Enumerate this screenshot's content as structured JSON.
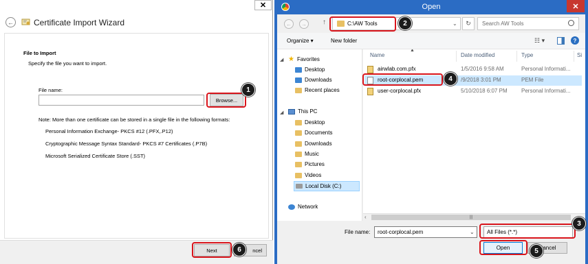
{
  "wizard": {
    "title": "Certificate Import Wizard",
    "close_glyph": "✕",
    "back_glyph": "←",
    "heading": "File to Import",
    "subheading": "Specify the file you want to import.",
    "file_name_label": "File name:",
    "file_name_value": "",
    "browse_label": "Browse...",
    "note": "Note:  More than one certificate can be stored in a single file in the following formats:",
    "formats": [
      "Personal Information Exchange- PKCS #12 (.PFX,.P12)",
      "Cryptographic Message Syntax Standard- PKCS #7 Certificates (.P7B)",
      "Microsoft Serialized Certificate Store (.SST)"
    ],
    "next_label": "Next",
    "cancel_label": "ncel"
  },
  "open_dialog": {
    "title": "Open",
    "close_glyph": "✕",
    "address": "C:\\AW Tools",
    "search_placeholder": "Search AW Tools",
    "toolbar": {
      "organize": "Organize ▾",
      "new_folder": "New folder",
      "view_glyph": "☷ ▾",
      "help_glyph": "?"
    },
    "nav": {
      "favorites": "Favorites",
      "favorites_items": [
        "Desktop",
        "Downloads",
        "Recent places"
      ],
      "this_pc": "This PC",
      "pc_items": [
        "Desktop",
        "Documents",
        "Downloads",
        "Music",
        "Pictures",
        "Videos",
        "Local Disk (C:)"
      ],
      "network": "Network"
    },
    "columns": [
      "Name",
      "Date modified",
      "Type",
      "Si"
    ],
    "files": [
      {
        "name": "airwlab.com.pfx",
        "date": "1/5/2016 9:58 AM",
        "type": "Personal Informati...",
        "kind": "pfx"
      },
      {
        "name": "root-corplocal.pem",
        "date": "/9/2018 3:01 PM",
        "type": "PEM File",
        "kind": "pem"
      },
      {
        "name": "user-corplocal.pfx",
        "date": "5/10/2018 6:07 PM",
        "type": "Personal Informati...",
        "kind": "pfx"
      }
    ],
    "file_name_label": "File name:",
    "file_name_value": "root-corplocal.pem",
    "file_type_value": "All Files (*.*)",
    "open_label": "Open",
    "cancel_label": "Cancel"
  },
  "annotations": [
    "1",
    "2",
    "3",
    "4",
    "5",
    "6"
  ],
  "colors": {
    "highlight": "#d9141b",
    "titlebar": "#2b6cc4",
    "badge": "#1c1c1c"
  }
}
